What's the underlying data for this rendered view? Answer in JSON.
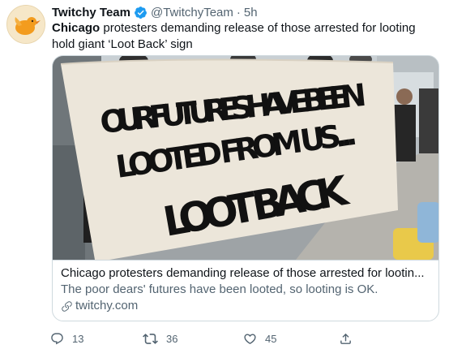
{
  "tweet": {
    "author_name": "Twitchy Team",
    "handle": "@TwitchyTeam",
    "separator": "·",
    "time": "5h",
    "text_bold": "Chicago",
    "text_rest": " protesters demanding release of those arrested for looting hold giant ‘Loot Back’ sign"
  },
  "card": {
    "title": "Chicago protesters demanding release of those arrested for lootin...",
    "description": "The poor dears' futures have been looted, so looting is OK.",
    "domain": "twitchy.com",
    "domain_icon": "link-icon",
    "photo_sign_lines": [
      "OUR FUTURES HAVE BEEN",
      "LOOTED FROM US...",
      "LOOT BACK"
    ]
  },
  "actions": {
    "replies": "13",
    "retweets": "36",
    "likes": "45",
    "icons": [
      "reply-icon",
      "retweet-icon",
      "like-icon",
      "share-icon"
    ]
  },
  "colors": {
    "text": "#0f1419",
    "secondary": "#536471",
    "verified": "#1d9bf0",
    "border": "#cfd9de"
  }
}
